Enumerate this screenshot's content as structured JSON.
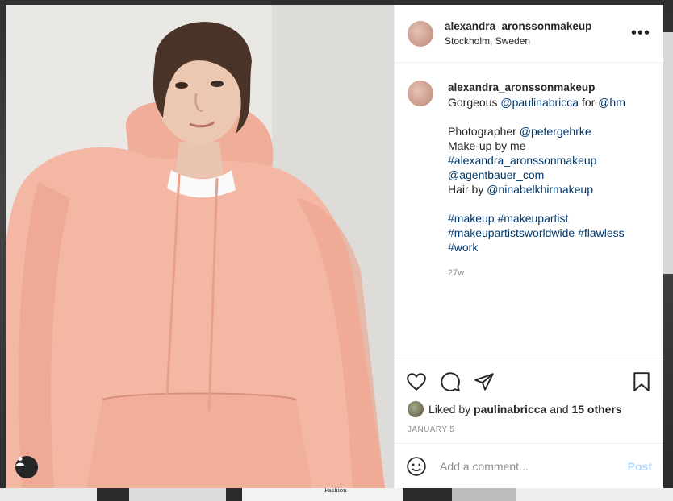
{
  "header": {
    "username": "alexandra_aronssonmakeup",
    "location": "Stockholm, Sweden",
    "more_icon": "more-dots-icon"
  },
  "caption": {
    "username": "alexandra_aronssonmakeup",
    "line1_prefix": "Gorgeous",
    "line1_mention1": "@paulinabricca",
    "line1_mid": "for",
    "line1_mention2": "@hm",
    "line2_prefix": "Photographer",
    "line2_mention": "@petergehrke",
    "line3": "Make-up by me",
    "line4_tag": "#alexandra_aronssonmakeup",
    "line5_mention": "@agentbauer_com",
    "line6_prefix": "Hair by",
    "line6_mention": "@ninabelkhirmakeup",
    "hashtags_line1_a": "#makeup",
    "hashtags_line1_b": "#makeupartist",
    "hashtags_line2_a": "#makeupartistsworldwide",
    "hashtags_line2_b": "#flawless",
    "hashtags_line3": "#work",
    "time": "27w"
  },
  "likes": {
    "prefix": "Liked by",
    "user": "paulinabricca",
    "and": "and",
    "others": "15 others"
  },
  "date": "JANUARY 5",
  "comment": {
    "placeholder": "Add a comment...",
    "post_label": "Post"
  },
  "background": {
    "caption_text": "Fashion"
  },
  "colors": {
    "link": "#00376b",
    "post_disabled": "#b3dbff",
    "hoodie": "#f4b7a3"
  }
}
